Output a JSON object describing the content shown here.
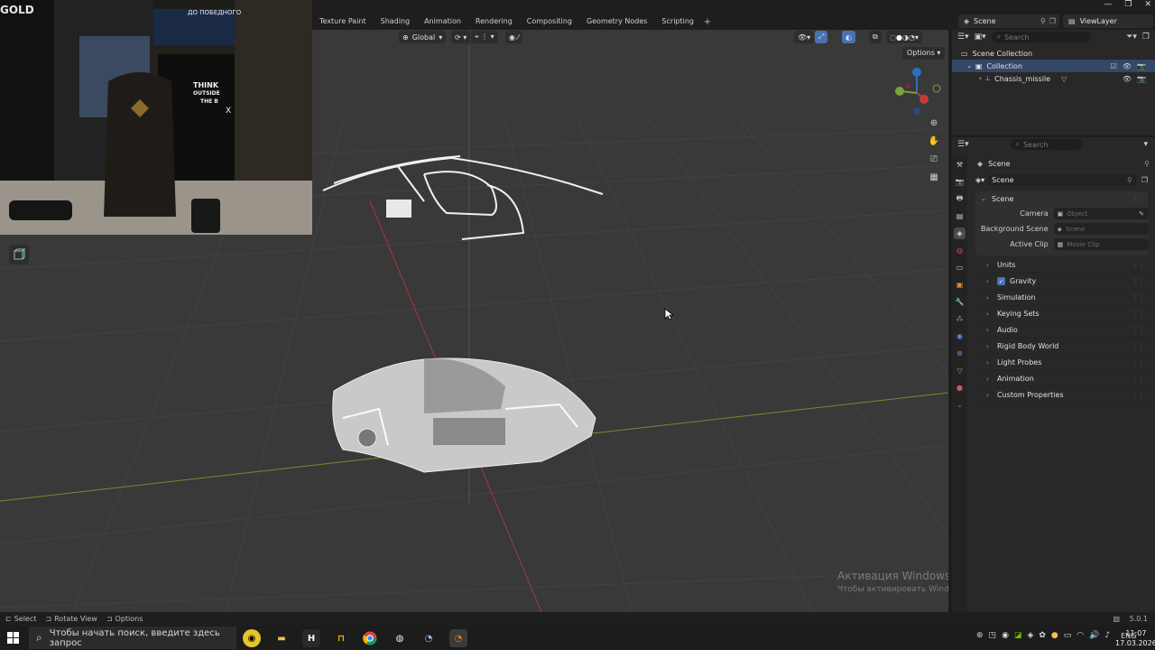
{
  "workspaces": [
    "Texture Paint",
    "Shading",
    "Animation",
    "Rendering",
    "Compositing",
    "Geometry Nodes",
    "Scripting"
  ],
  "window": {
    "minimize": "—",
    "maximize": "❐",
    "close": "✕"
  },
  "scene_selector": "Scene",
  "viewlayer_selector": "ViewLayer",
  "viewport": {
    "transform_orientation": "Global",
    "options": "Options"
  },
  "webcam": {
    "sign_gold": "GOLD",
    "sign_think": "THINK",
    "sign_outside": "OUTSIDE",
    "sign_the_b": "THE B",
    "sign_x": "X",
    "sign_top": "ДО ПОБЕДНОГО"
  },
  "outliner": {
    "search_placeholder": "Search",
    "scene_collection": "Scene Collection",
    "collection": "Collection",
    "object": "Chassis_missile"
  },
  "properties": {
    "search_placeholder": "Search",
    "breadcrumb": "Scene",
    "datablock": "Scene",
    "scene_panel": {
      "title": "Scene",
      "camera_label": "Camera",
      "camera_placeholder": "Object",
      "bg_label": "Background Scene",
      "bg_placeholder": "Scene",
      "clip_label": "Active Clip",
      "clip_placeholder": "Movie Clip"
    },
    "panels": [
      "Units",
      "Gravity",
      "Simulation",
      "Keying Sets",
      "Audio",
      "Rigid Body World",
      "Light Probes",
      "Animation",
      "Custom Properties"
    ]
  },
  "statusbar": {
    "select": "Select",
    "rotate": "Rotate View",
    "options": "Options",
    "version": "5.0.1"
  },
  "watermark": {
    "title": "Активация Windows",
    "subtitle": "Чтобы активировать Windows, перейдите в раздел \"Параметры\"."
  },
  "taskbar": {
    "search_placeholder": "Чтобы начать поиск, введите здесь запрос",
    "lang": "ENG",
    "time": "11:07",
    "date": "17.03.2026"
  },
  "colors": {
    "accent": "#4772b3",
    "x_axis": "#b23a3a",
    "y_axis": "#7fa03a",
    "viewport_bg": "#393939"
  }
}
